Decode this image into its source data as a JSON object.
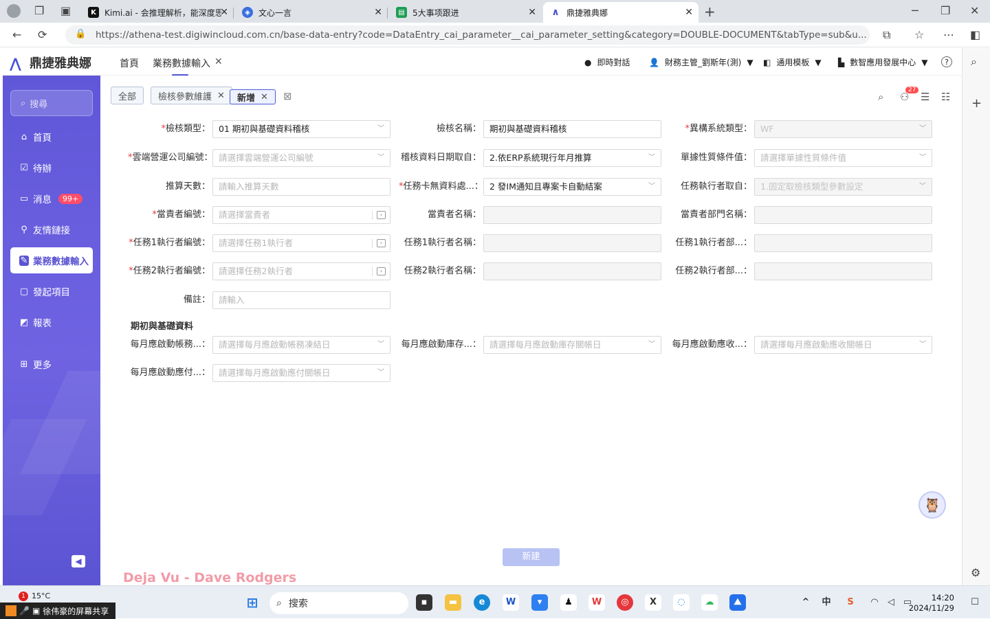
{
  "browser": {
    "tabs": [
      {
        "title": "Kimi.ai - 会推理解析，能深度思考",
        "icon": "kimi-icon"
      },
      {
        "title": "文心一言",
        "icon": "wenxin-icon"
      },
      {
        "title": "5大事项跟进",
        "icon": "sheet-icon"
      },
      {
        "title": "鼎捷雅典娜",
        "icon": "athena-icon"
      }
    ],
    "url": "https://athena-test.digiwincloud.com.cn/base-data-entry?code=DataEntry_cai_parameter__cai_parameter_setting&category=DOUBLE-DOCUMENT&tabType=sub&u..."
  },
  "app": {
    "logo_text": "鼎捷雅典娜",
    "nav_home": "首頁",
    "nav_active": "業務數據輸入",
    "header_chat": "即時對話",
    "header_user": "財務主管_劉斯年(測)",
    "header_template": "通用模板",
    "header_center": "數智應用發展中心"
  },
  "sidebar": {
    "search_placeholder": "搜尋",
    "items": [
      {
        "label": "首頁",
        "icon": "home-icon"
      },
      {
        "label": "待辦",
        "icon": "todo-icon"
      },
      {
        "label": "消息",
        "icon": "message-icon",
        "badge": "99+"
      },
      {
        "label": "友情鏈接",
        "icon": "link-icon"
      },
      {
        "label": "業務數據輸入",
        "icon": "data-entry-icon"
      },
      {
        "label": "發起項目",
        "icon": "project-icon"
      },
      {
        "label": "報表",
        "icon": "report-icon"
      },
      {
        "label": "更多",
        "icon": "more-icon"
      }
    ]
  },
  "main": {
    "filter_tabs": [
      "全部",
      "檢核參數維護",
      "新增"
    ],
    "notify_count": "27",
    "form": {
      "check_type_label": "檢核類型",
      "check_type_value": "01 期初與基礎資料稽核",
      "check_name_label": "檢核名稱",
      "check_name_value": "期初與基礎資料稽核",
      "sys_type_label": "異構系統類型",
      "sys_type_value": "WF",
      "company_label": "雲端營運公司編號",
      "company_placeholder": "請選擇雲端營運公司編號",
      "date_source_label": "稽核資料日期取自",
      "date_source_value": "2.依ERP系統現行年月推算",
      "doc_cond_label": "單據性質條件值",
      "doc_cond_placeholder": "請選擇單據性質條件值",
      "days_label": "推算天數",
      "days_placeholder": "請輸入推算天數",
      "card_label": "任務卡無資料處...",
      "card_value": "2 發IM通知且專案卡自動結案",
      "executor_label": "任務執行者取自",
      "executor_value": "1.固定取檢核類型參數設定",
      "owner_id_label": "當責者編號",
      "owner_id_placeholder": "請選擇當責者",
      "owner_name_label": "當責者名稱",
      "owner_dept_label": "當責者部門名稱",
      "t1_id_label": "任務1執行者編號",
      "t1_id_placeholder": "請選擇任務1執行者",
      "t1_name_label": "任務1執行者名稱",
      "t1_dept_label": "任務1執行者部...",
      "t2_id_label": "任務2執行者編號",
      "t2_id_placeholder": "請選擇任務2執行者",
      "t2_name_label": "任務2執行者名稱",
      "t2_dept_label": "任務2執行者部...",
      "remark_label": "備註",
      "remark_placeholder": "請輸入"
    },
    "section_title": "期初與基礎資料",
    "section": {
      "f1_label": "每月應啟動帳務...",
      "f1_placeholder": "請選擇每月應啟動帳務凍結日",
      "f2_label": "每月應啟動庫存...",
      "f2_placeholder": "請選擇每月應啟動庫存關帳日",
      "f3_label": "每月應啟動應收...",
      "f3_placeholder": "請選擇每月應啟動應收關帳日",
      "f4_label": "每月應啟動應付...",
      "f4_placeholder": "請選擇每月應啟動應付關帳日"
    },
    "submit_label": "新建",
    "watermark": "Deja Vu - Dave Rodgers"
  },
  "taskbar": {
    "weather": "15°C",
    "weather_badge": "1",
    "share_text": "徐伟豪的屏幕共享",
    "search_label": "搜索",
    "time": "14:20",
    "date": "2024/11/29"
  }
}
